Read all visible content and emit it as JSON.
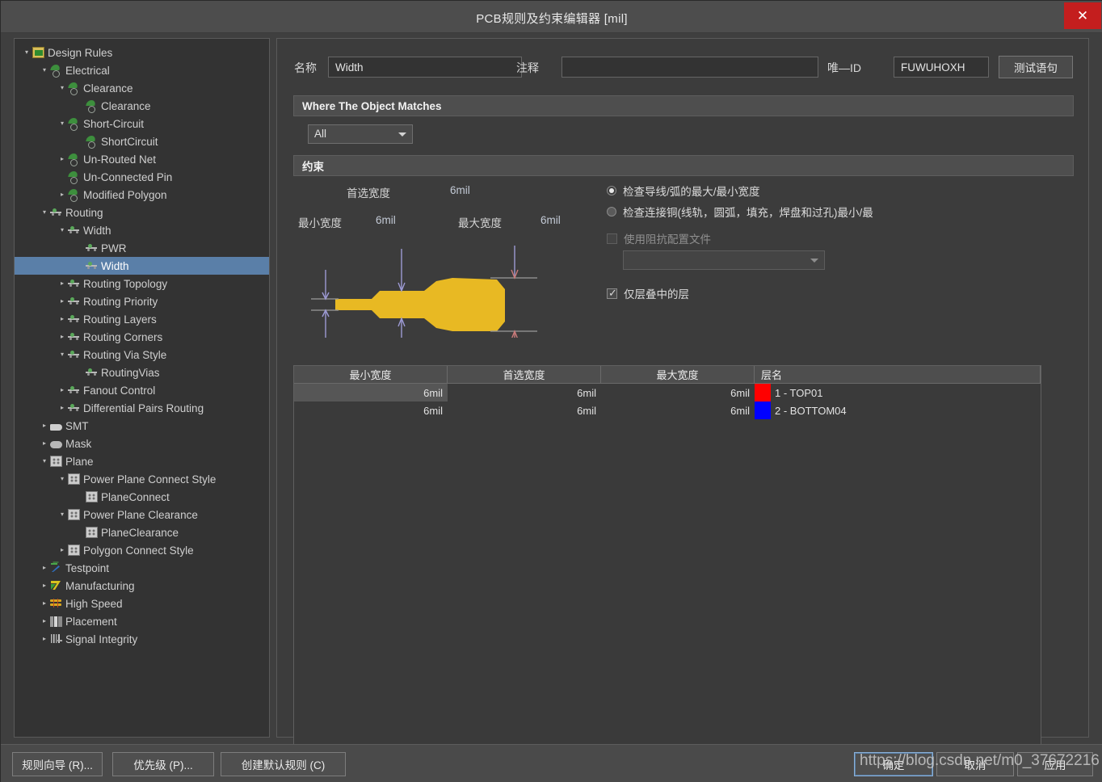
{
  "window": {
    "title": "PCB规则及约束编辑器 [mil]",
    "close_label": "✕"
  },
  "tree": {
    "nodes": [
      {
        "label": "Design Rules",
        "depth": 0,
        "twist": "▾",
        "icon": "root",
        "selected": false
      },
      {
        "label": "Electrical",
        "depth": 1,
        "twist": "▾",
        "icon": "elec",
        "selected": false
      },
      {
        "label": "Clearance",
        "depth": 2,
        "twist": "▾",
        "icon": "elec",
        "selected": false
      },
      {
        "label": "Clearance",
        "depth": 3,
        "twist": "",
        "icon": "elec",
        "selected": false
      },
      {
        "label": "Short-Circuit",
        "depth": 2,
        "twist": "▾",
        "icon": "elec",
        "selected": false
      },
      {
        "label": "ShortCircuit",
        "depth": 3,
        "twist": "",
        "icon": "elec",
        "selected": false
      },
      {
        "label": "Un-Routed Net",
        "depth": 2,
        "twist": "▸",
        "icon": "elec",
        "selected": false
      },
      {
        "label": "Un-Connected Pin",
        "depth": 2,
        "twist": "",
        "icon": "elec",
        "selected": false
      },
      {
        "label": "Modified Polygon",
        "depth": 2,
        "twist": "▸",
        "icon": "elec",
        "selected": false
      },
      {
        "label": "Routing",
        "depth": 1,
        "twist": "▾",
        "icon": "route",
        "selected": false
      },
      {
        "label": "Width",
        "depth": 2,
        "twist": "▾",
        "icon": "route",
        "selected": false
      },
      {
        "label": "PWR",
        "depth": 3,
        "twist": "",
        "icon": "route",
        "selected": false
      },
      {
        "label": "Width",
        "depth": 3,
        "twist": "",
        "icon": "route",
        "selected": true
      },
      {
        "label": "Routing Topology",
        "depth": 2,
        "twist": "▸",
        "icon": "route",
        "selected": false
      },
      {
        "label": "Routing Priority",
        "depth": 2,
        "twist": "▸",
        "icon": "route",
        "selected": false
      },
      {
        "label": "Routing Layers",
        "depth": 2,
        "twist": "▸",
        "icon": "route",
        "selected": false
      },
      {
        "label": "Routing Corners",
        "depth": 2,
        "twist": "▸",
        "icon": "route",
        "selected": false
      },
      {
        "label": "Routing Via Style",
        "depth": 2,
        "twist": "▾",
        "icon": "route",
        "selected": false
      },
      {
        "label": "RoutingVias",
        "depth": 3,
        "twist": "",
        "icon": "route",
        "selected": false
      },
      {
        "label": "Fanout Control",
        "depth": 2,
        "twist": "▸",
        "icon": "route",
        "selected": false
      },
      {
        "label": "Differential Pairs Routing",
        "depth": 2,
        "twist": "▸",
        "icon": "route",
        "selected": false
      },
      {
        "label": "SMT",
        "depth": 1,
        "twist": "▸",
        "icon": "smt",
        "selected": false
      },
      {
        "label": "Mask",
        "depth": 1,
        "twist": "▸",
        "icon": "mask",
        "selected": false
      },
      {
        "label": "Plane",
        "depth": 1,
        "twist": "▾",
        "icon": "plane",
        "selected": false
      },
      {
        "label": "Power Plane Connect Style",
        "depth": 2,
        "twist": "▾",
        "icon": "plane",
        "selected": false
      },
      {
        "label": "PlaneConnect",
        "depth": 3,
        "twist": "",
        "icon": "plane",
        "selected": false
      },
      {
        "label": "Power Plane Clearance",
        "depth": 2,
        "twist": "▾",
        "icon": "plane",
        "selected": false
      },
      {
        "label": "PlaneClearance",
        "depth": 3,
        "twist": "",
        "icon": "plane",
        "selected": false
      },
      {
        "label": "Polygon Connect Style",
        "depth": 2,
        "twist": "▸",
        "icon": "plane",
        "selected": false
      },
      {
        "label": "Testpoint",
        "depth": 1,
        "twist": "▸",
        "icon": "test",
        "selected": false
      },
      {
        "label": "Manufacturing",
        "depth": 1,
        "twist": "▸",
        "icon": "manu",
        "selected": false
      },
      {
        "label": "High Speed",
        "depth": 1,
        "twist": "▸",
        "icon": "hs",
        "selected": false
      },
      {
        "label": "Placement",
        "depth": 1,
        "twist": "▸",
        "icon": "place",
        "selected": false
      },
      {
        "label": "Signal Integrity",
        "depth": 1,
        "twist": "▸",
        "icon": "sig",
        "selected": false
      }
    ]
  },
  "form": {
    "name_label": "名称",
    "name_value": "Width",
    "comment_label": "注释",
    "comment_value": "",
    "unique_id_label": "唯—ID",
    "unique_id_value": "FUWUHOXH",
    "test_query_button": "测试语句"
  },
  "where_section": {
    "header": "Where The Object Matches",
    "scope_value": "All"
  },
  "constraint_section": {
    "header": "约束",
    "preferred_width_label": "首选宽度",
    "preferred_width_value": "6mil",
    "min_width_label": "最小宽度",
    "min_width_value": "6mil",
    "max_width_label": "最大宽度",
    "max_width_value": "6mil",
    "radio_track_arc": "检查导线/弧的最大/最小宽度",
    "radio_connected_copper": "检查连接铜(线轨，圆弧，填充，焊盘和过孔)最小/最",
    "impedance_checkbox": "使用阻抗配置文件",
    "impedance_profile_value": "",
    "layers_in_stack_checkbox": "仅层叠中的层"
  },
  "table": {
    "columns": [
      "最小宽度",
      "首选宽度",
      "最大宽度",
      "层名"
    ],
    "rows": [
      {
        "min": "6mil",
        "preferred": "6mil",
        "max": "6mil",
        "layer": "1 - TOP01",
        "color": "#FF0000",
        "selected": true
      },
      {
        "min": "6mil",
        "preferred": "6mil",
        "max": "6mil",
        "layer": "2 - BOTTOM04",
        "color": "#0000FF",
        "selected": false
      }
    ]
  },
  "footer": {
    "rule_wizard": "规则向导 (R)...",
    "priorities": "优先级 (P)...",
    "create_default_rules": "创建默认规则 (C)",
    "ok": "确定",
    "cancel": "取消",
    "apply": "应用"
  },
  "watermark": {
    "text": "https://blog.csdn.net/m0_37672216"
  }
}
